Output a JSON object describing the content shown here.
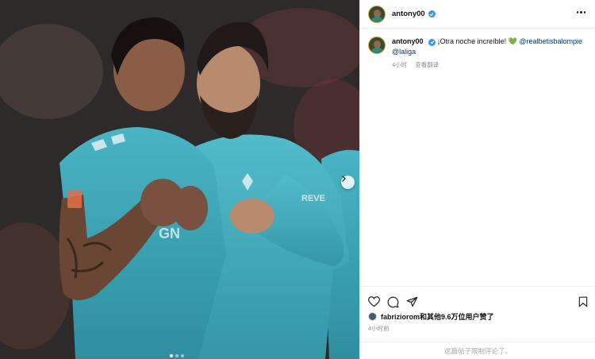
{
  "post": {
    "username": "antony00",
    "verified": true,
    "image_alt": "Two football players in teal Real Betis kits celebrating, one pointing at the crest",
    "carousel": {
      "dot_count": 3,
      "active_index": 0
    }
  },
  "caption": {
    "username": "antony00",
    "text": "¡Otra noche increíble!",
    "emoji": "💚",
    "mention_1": "@realbetisbalompie",
    "mention_2": "@laliga",
    "time": "4小时",
    "translate": "查看翻译"
  },
  "actions": {
    "like_icon": "heart-icon",
    "comment_icon": "comment-icon",
    "share_icon": "share-icon",
    "save_icon": "bookmark-icon"
  },
  "likes": {
    "liker": "fabriziorom",
    "rest": "和其他9.6万位用户",
    "suffix": "赞了"
  },
  "time_ago": "4小时前",
  "comments_disabled": "这篇帖子限制评论了。",
  "colors": {
    "verified": "#3897f0",
    "mention": "#00376b",
    "kit": "#3aa8b8"
  }
}
